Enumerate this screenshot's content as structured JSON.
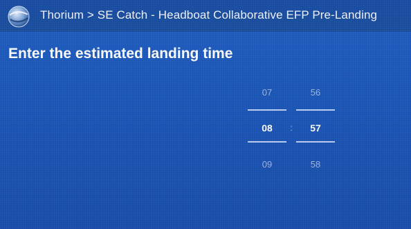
{
  "header": {
    "app_name": "Thorium",
    "breadcrumb_separator": ">",
    "page_title": "SE Catch - Headboat Collaborative EFP Pre-Landing",
    "logo_icon": "globe-icon"
  },
  "main": {
    "prompt": "Enter the estimated landing time"
  },
  "time_picker": {
    "hours": {
      "previous": "07",
      "selected": "08",
      "next": "09"
    },
    "separator": ":",
    "minutes": {
      "previous": "56",
      "selected": "57",
      "next": "58"
    }
  },
  "colors": {
    "background": "#1c57b8",
    "titlebar": "#1a4ea6",
    "text_primary": "#ffffff",
    "text_muted": "#9fb6e0"
  }
}
